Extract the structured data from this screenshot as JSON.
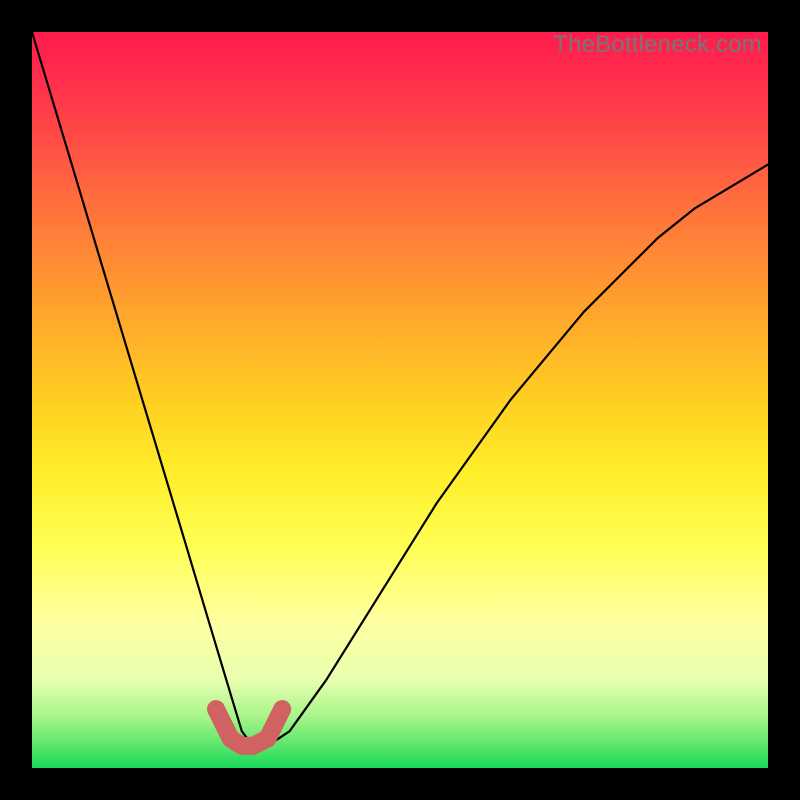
{
  "watermark": "TheBottleneck.com",
  "colors": {
    "frame": "#000000",
    "curve": "#000000",
    "u_marker": "#d06262",
    "gradient_top": "#ff1a4d",
    "gradient_bottom": "#16d85a"
  },
  "chart_data": {
    "type": "line",
    "title": "",
    "xlabel": "",
    "ylabel": "",
    "xlim": [
      0,
      100
    ],
    "ylim": [
      0,
      100
    ],
    "grid": false,
    "legend": false,
    "annotations": [
      "TheBottleneck.com"
    ],
    "series": [
      {
        "name": "bottleneck-curve",
        "x": [
          0,
          3,
          6,
          9,
          12,
          15,
          18,
          21,
          24,
          27,
          28.5,
          30,
          32,
          35,
          40,
          45,
          50,
          55,
          60,
          65,
          70,
          75,
          80,
          85,
          90,
          95,
          100
        ],
        "y": [
          100,
          90,
          80,
          70,
          60,
          50,
          40,
          30,
          20,
          10,
          5,
          3,
          3,
          5,
          12,
          20,
          28,
          36,
          43,
          50,
          56,
          62,
          67,
          72,
          76,
          79,
          82
        ]
      }
    ],
    "u_marker": {
      "x": [
        25,
        27,
        28.5,
        30,
        32,
        34
      ],
      "y": [
        8,
        4,
        3,
        3,
        4,
        8
      ]
    }
  }
}
